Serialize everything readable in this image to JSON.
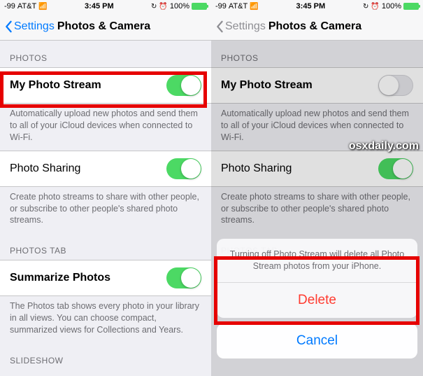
{
  "status": {
    "signal": "-99",
    "carrier": "AT&T",
    "time": "3:45 PM",
    "battery_pct": "100%"
  },
  "nav": {
    "back": "Settings",
    "title": "Photos & Camera"
  },
  "sections": {
    "photos_header": "PHOTOS",
    "photo_stream_label": "My Photo Stream",
    "photo_stream_footer": "Automatically upload new photos and send them to all of your iCloud devices when connected to Wi-Fi.",
    "photo_sharing_label": "Photo Sharing",
    "photo_sharing_footer": "Create photo streams to share with other people, or subscribe to other people's shared photo streams.",
    "photos_tab_header": "PHOTOS TAB",
    "summarize_label": "Summarize Photos",
    "summarize_footer": "The Photos tab shows every photo in your library in all views. You can choose compact, summarized views for Collections and Years.",
    "slideshow_header": "SLIDESHOW"
  },
  "sheet": {
    "message": "Turning off Photo Stream will delete all Photo Stream photos from your iPhone.",
    "delete": "Delete",
    "cancel": "Cancel"
  },
  "watermark": "osxdaily.com"
}
